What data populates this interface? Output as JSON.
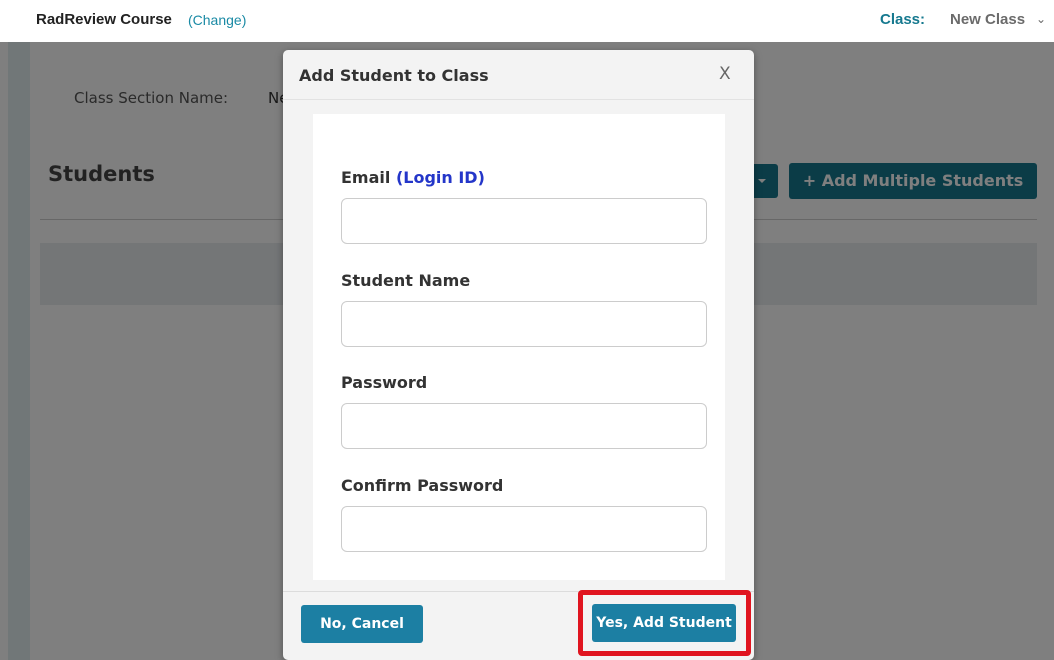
{
  "header": {
    "course_title": "RadReview Course",
    "change_link": "(Change)",
    "class_label": "Class:",
    "class_value": "New Class",
    "class_chevron_icon": "chevron-down-icon"
  },
  "page": {
    "section_name_label": "Class Section Name:",
    "section_name_value": "Ne",
    "students_heading": "Students",
    "dropdown_caret_icon": "caret-down-icon",
    "add_multiple_label": "+ Add Multiple Students"
  },
  "modal": {
    "title": "Add Student to Class",
    "close_label": "X",
    "fields": {
      "email_label": "Email",
      "email_hint": "(Login ID)",
      "email_value": "",
      "name_label": "Student Name",
      "name_value": "",
      "password_label": "Password",
      "password_value": "",
      "confirm_label": "Confirm Password",
      "confirm_value": ""
    },
    "cancel_label": "No, Cancel",
    "submit_label": "Yes, Add Student"
  },
  "colors": {
    "accent": "#16798f",
    "button": "#1c7fa3",
    "highlight": "#e0141f",
    "link_hint": "#2436c9"
  }
}
